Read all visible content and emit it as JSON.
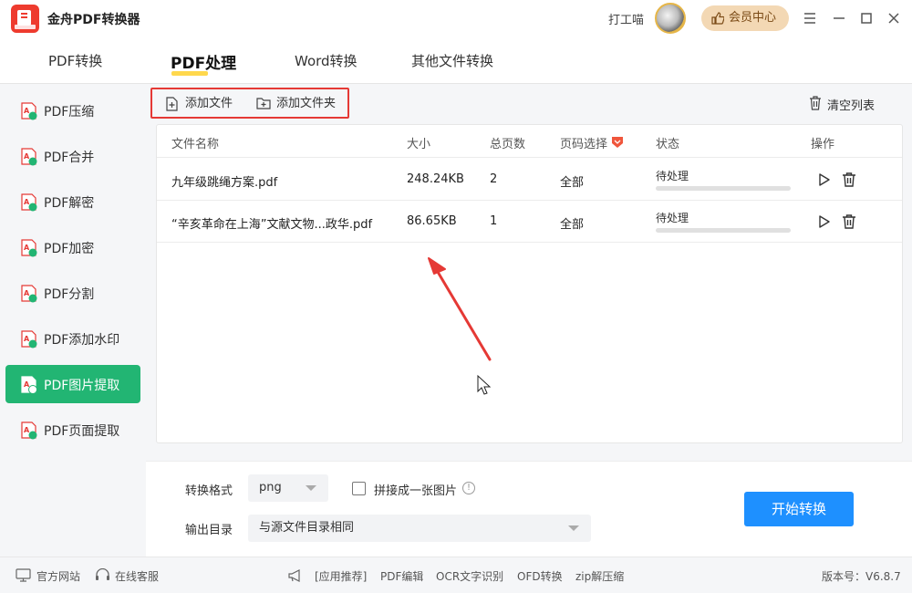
{
  "app": {
    "title": "金舟PDF转换器",
    "logo_icon": "pdf-app-logo-icon",
    "brand_color": "#ee3b2e"
  },
  "user": {
    "name": "打工喵",
    "vip_label": "会员中心"
  },
  "topnav": {
    "tabs": [
      {
        "label": "PDF转换"
      },
      {
        "label": "PDF处理"
      },
      {
        "label": "Word转换"
      },
      {
        "label": "其他文件转换"
      }
    ],
    "active": "PDF处理"
  },
  "sidebar": {
    "items": [
      {
        "label": "PDF压缩"
      },
      {
        "label": "PDF合并"
      },
      {
        "label": "PDF解密"
      },
      {
        "label": "PDF加密"
      },
      {
        "label": "PDF分割"
      },
      {
        "label": "PDF添加水印"
      },
      {
        "label": "PDF图片提取"
      },
      {
        "label": "PDF页面提取"
      }
    ],
    "active": "PDF图片提取",
    "active_color": "#22b573"
  },
  "toolbar": {
    "add_file": "添加文件",
    "add_folder": "添加文件夹",
    "clear_list": "清空列表"
  },
  "table": {
    "columns": [
      "文件名称",
      "大小",
      "总页数",
      "页码选择",
      "状态",
      "操作"
    ],
    "rows": [
      {
        "name": "九年级跳绳方案.pdf",
        "size": "248.24KB",
        "pages": "2",
        "range": "全部",
        "status": "待处理",
        "progress": 0
      },
      {
        "name": "“辛亥革命在上海”文献文物...政华.pdf",
        "size": "86.65KB",
        "pages": "1",
        "range": "全部",
        "status": "待处理",
        "progress": 0
      }
    ]
  },
  "settings": {
    "format_label": "转换格式",
    "format_value": "png",
    "merge_label": "拼接成一张图片",
    "merge_checked": false,
    "output_label": "输出目录",
    "output_value": "与源文件目录相同",
    "start_label": "开始转换",
    "start_color": "#1e90ff"
  },
  "footer": {
    "official_site": "官方网站",
    "online_service": "在线客服",
    "recommend": "[应用推荐]",
    "links": [
      "PDF编辑",
      "OCR文字识别",
      "OFD转换",
      "zip解压缩"
    ],
    "version": "版本号：V6.8.7"
  }
}
